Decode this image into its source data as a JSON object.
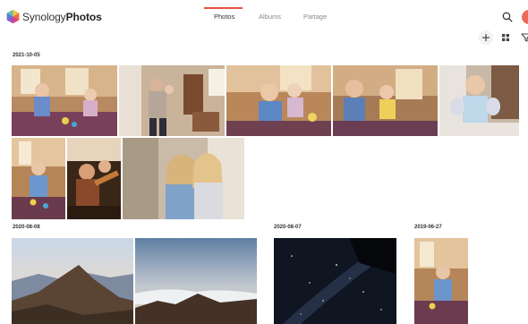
{
  "app": {
    "brand_part1": "Synology",
    "brand_part2": "Photos"
  },
  "tabs": [
    {
      "label": "Photos",
      "active": true
    },
    {
      "label": "Albums",
      "active": false
    },
    {
      "label": "Partage",
      "active": false
    }
  ],
  "icons": {
    "logo": "synology-photos-logo-icon",
    "search": "search-icon",
    "add": "plus-icon",
    "view": "grid-view-icon",
    "filter": "filter-icon"
  },
  "accent_color": "#e8533f",
  "sections": [
    {
      "date": "2021-10-05",
      "photo_count": 9
    },
    {
      "date": "2020-08-08",
      "photo_count": 2
    },
    {
      "date": "2020-08-07",
      "photo_count": 1
    },
    {
      "date": "2019-06-27",
      "photo_count": 1
    }
  ]
}
